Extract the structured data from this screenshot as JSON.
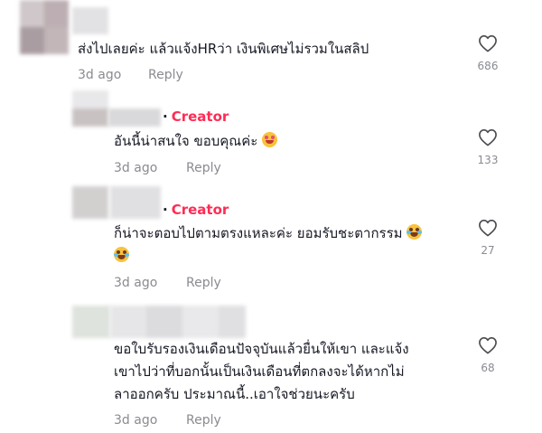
{
  "comments": [
    {
      "text_lines": [
        "ส่งไปเลยค่ะ แล้วแจ้งHRว่า เงินพิเศษไม่รวมในสลิป"
      ],
      "time": "3d ago",
      "reply_label": "Reply",
      "likes": "686"
    },
    {
      "badge": "Creator",
      "text_lines": [
        "อันนี้น่าสนใจ ขอบคุณค่ะ"
      ],
      "emoji": "smiling-face-with-hearts",
      "time": "3d ago",
      "reply_label": "Reply",
      "likes": "133"
    },
    {
      "badge": "Creator",
      "text_lines": [
        "ก็น่าจะตอบไปตามตรงแหละค่ะ ยอมรับชะตากรรม"
      ],
      "emoji": "face-with-tears-of-joy",
      "time": "3d ago",
      "reply_label": "Reply",
      "likes": "27"
    },
    {
      "text_lines": [
        "ขอใบรับรองเงินเดือนปัจจุบันแล้วยื่นให้เขา และแจ้ง",
        "เขาไปว่าที่บอกนั้นเป็นเงินเดือนที่ตกลงจะได้หากไม่",
        "ลาออกครับ ประมาณนี้..เอาใจช่วยนะครับ"
      ],
      "time": "3d ago",
      "reply_label": "Reply",
      "likes": "68"
    }
  ],
  "colors": {
    "creator": "#fe2c55",
    "meta": "#8a8b91",
    "text": "#161823"
  },
  "icons": {
    "like": "heart-outline-icon"
  }
}
